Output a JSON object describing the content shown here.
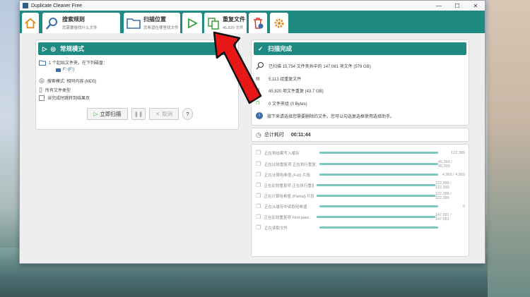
{
  "window": {
    "title": "Duplicate Cleaner Free"
  },
  "toolbar": {
    "tabs": [
      {
        "title": "搜索规则",
        "subtitle": "您需要搜找什么文件"
      },
      {
        "title": "扫描位置",
        "subtitle": "您希望在哪里找文件"
      },
      {
        "title": "重复文件",
        "subtitle": "45,820 文件"
      }
    ]
  },
  "left": {
    "header": "常规模式",
    "folder_summary": "1 个起始文件夹，在下列磁盘：",
    "drive": "F: (F:)",
    "mode": "搜索模式: 相同内容 (MD5)",
    "file_types": "所有文件类型",
    "checkbox_label": "当完成时跳转到结果页",
    "scan_button": "立即扫描",
    "cancel_button": "取消",
    "help": "?"
  },
  "right": {
    "header": "扫描完成",
    "scanned": "已扫描 15,754 文件夹共中的 147,081 项文件 (579 GB)",
    "dup_groups": "5,113 组重复文件",
    "dup_files": "45,820 项文件重复 (43.7 GB)",
    "zero_files": "0 文件夹组 (0 Bytes)",
    "hint": "接下来请选择您需要删除的文件。您可以勾选复选框使用选择助手。",
    "elapsed_label": "总计耗时",
    "elapsed_value": "00:11:44"
  },
  "progress": [
    {
      "label": "正在将结果写入缓存",
      "value": "122,389",
      "fraction": 1.0
    },
    {
      "label": "正在比较重复项 正在执行重复文件检测 (2)",
      "value": "45,399 / 45,399",
      "fraction": 1.0
    },
    {
      "label": "正在计算哈希值 (Full) 片段",
      "value": "4,965 / 4,965",
      "fraction": 1.0
    },
    {
      "label": "正在比较重复项 正在执行重复文件检测 (2)",
      "value": "122,389 / 122,389",
      "fraction": 1.0
    },
    {
      "label": "正在计算哈希值 (Partial) 片段",
      "value": "122,389 / 122,389",
      "fraction": 1.0
    },
    {
      "label": "正在从缓存中读取哈希值",
      "value": "0",
      "fraction": 1.0
    },
    {
      "label": "正在比较重复项 First pass",
      "value": "147,081 / 147,081",
      "fraction": 1.0
    },
    {
      "label": "正在读取文件",
      "value": "",
      "fraction": 1.0
    }
  ]
}
